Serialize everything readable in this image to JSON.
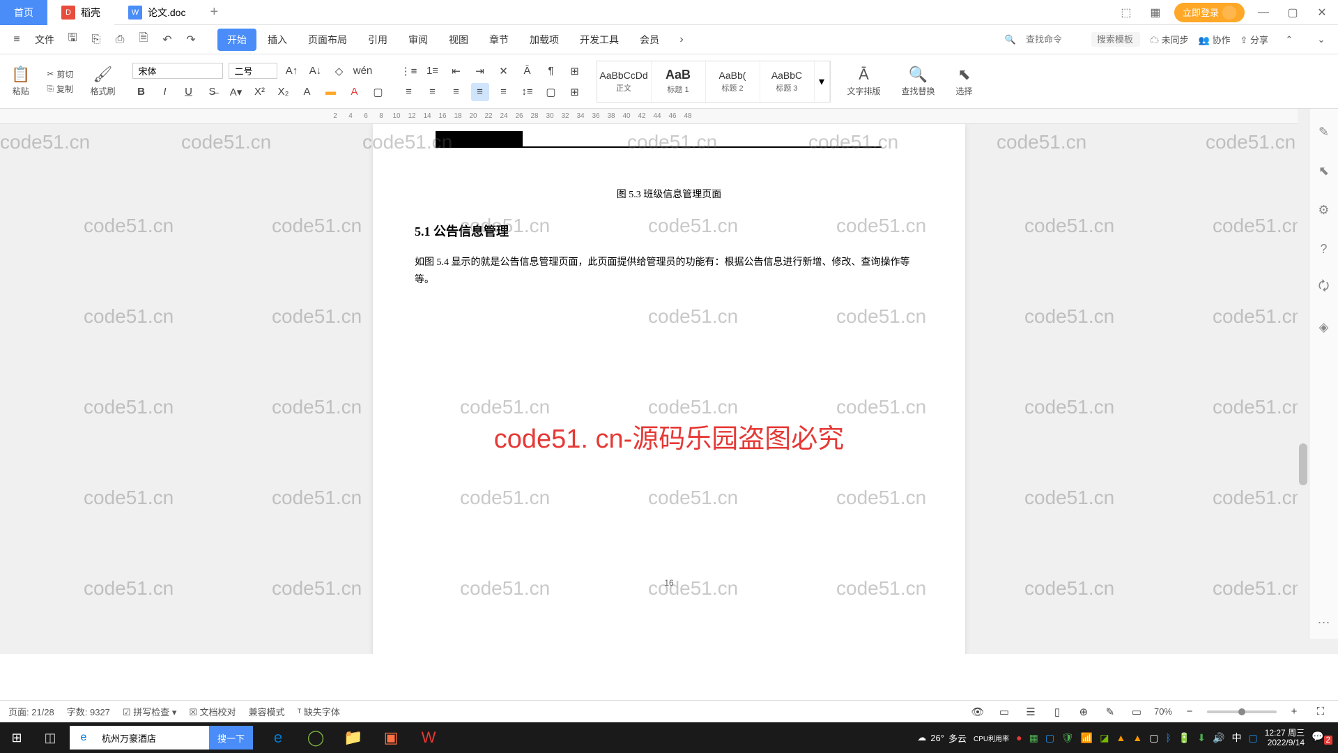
{
  "tabs": {
    "home": "首页",
    "docker": "稻壳",
    "doc": "论文.doc"
  },
  "titlebar": {
    "login": "立即登录"
  },
  "menubar": {
    "file": "文件",
    "tabs": [
      "开始",
      "插入",
      "页面布局",
      "引用",
      "审阅",
      "视图",
      "章节",
      "加载项",
      "开发工具",
      "会员"
    ],
    "search_cmd_placeholder": "查找命令",
    "search_tpl_placeholder": "搜索模板",
    "unsync": "未同步",
    "collab": "协作",
    "share": "分享"
  },
  "ribbon": {
    "paste": "粘贴",
    "cut": "剪切",
    "copy": "复制",
    "format_painter": "格式刷",
    "font_name": "宋体",
    "font_size": "二号",
    "styles": {
      "normal_preview": "AaBbCcDd",
      "normal": "正文",
      "h1_preview": "AaB",
      "h1": "标题 1",
      "h2_preview": "AaBb(",
      "h2": "标题 2",
      "h3_preview": "AaBbC",
      "h3": "标题 3"
    },
    "text_layout": "文字排版",
    "find_replace": "查找替换",
    "select": "选择"
  },
  "ruler_ticks": [
    "2",
    "4",
    "6",
    "8",
    "10",
    "12",
    "14",
    "16",
    "18",
    "20",
    "22",
    "24",
    "26",
    "28",
    "30",
    "32",
    "34",
    "36",
    "38",
    "40",
    "42",
    "44",
    "46",
    "48"
  ],
  "document": {
    "caption": "图 5.3  班级信息管理页面",
    "heading": "5.1 公告信息管理",
    "body": "如图 5.4 显示的就是公告信息管理页面，此页面提供给管理员的功能有：根据公告信息进行新增、修改、查询操作等等。",
    "page_num": "16"
  },
  "watermark": {
    "text": "code51.cn",
    "red": "code51. cn-源码乐园盗图必究"
  },
  "statusbar": {
    "page": "页面: 21/28",
    "words": "字数: 9327",
    "spellcheck": "拼写检查",
    "proofing": "文档校对",
    "compat": "兼容模式",
    "missing_font": "缺失字体",
    "zoom": "70%"
  },
  "taskbar": {
    "search_value": "杭州万豪酒店",
    "search_btn": "搜一下",
    "weather_temp": "26°",
    "weather_desc": "多云",
    "cpu": "CPU利用率",
    "ime": "中",
    "time": "12:27 周三",
    "date": "2022/9/14",
    "notif_count": "2"
  }
}
